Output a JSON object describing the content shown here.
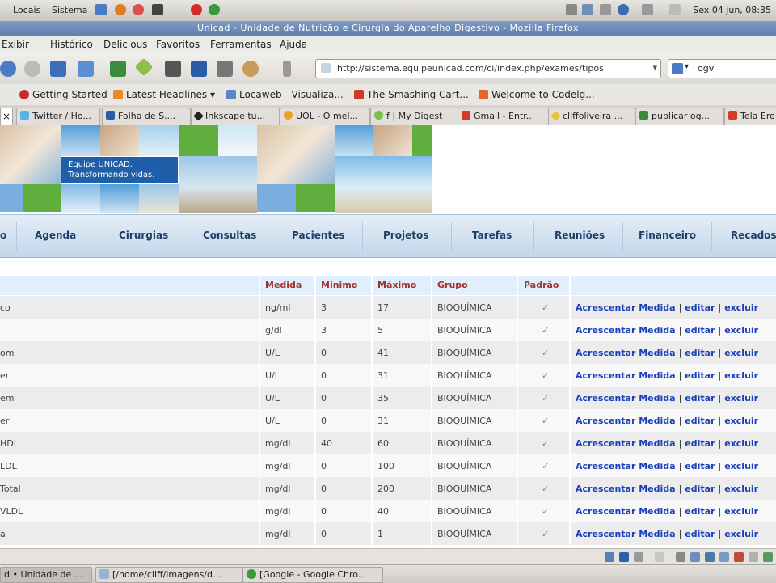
{
  "panel": {
    "menus": [
      "Locais",
      "Sistema"
    ],
    "clock": "Sex 04 jun, 08:35"
  },
  "window": {
    "title": "Unicad - Unidade de Nutrição e Cirurgia do Aparelho Digestivo - Mozilla Firefox"
  },
  "menubar": [
    "Exibir",
    "Histórico",
    "Delicious",
    "Favoritos",
    "Ferramentas",
    "Ajuda"
  ],
  "toolbar": {
    "url": "http://sistema.equipeunicad.com/ci/index.php/exames/tipos",
    "search_value": "ogv"
  },
  "bookmarks": [
    "Getting Started",
    "Latest Headlines",
    "Locaweb - Visualiza...",
    "The Smashing Cart...",
    "Welcome to Codelg..."
  ],
  "tabs": [
    "Twitter / Ho...",
    "Folha de S....",
    "Inkscape tu...",
    "UOL - O mel...",
    "f | My Digest",
    "Gmail - Entr...",
    "cliffoliveira ...",
    "publicar og...",
    "Tela Ero"
  ],
  "banner": {
    "caption_line1": "Equipe UNICAD.",
    "caption_line2": "Transformando vidas."
  },
  "nav": [
    "o",
    "Agenda",
    "Cirurgias",
    "Consultas",
    "Pacientes",
    "Projetos",
    "Tarefas",
    "Reuniões",
    "Financeiro",
    "Recados"
  ],
  "table": {
    "headers": [
      "Medida",
      "Mínimo",
      "Máximo",
      "Grupo",
      "Padrão"
    ],
    "check_mark": "✓",
    "actions": {
      "add": "Acrescentar Medida",
      "edit": "editar",
      "delete": "excluir",
      "sep": "|"
    },
    "rows": [
      {
        "name": "co",
        "medida": "ng/ml",
        "min": "3",
        "max": "17",
        "grupo": "BIOQUÍMICA"
      },
      {
        "name": "",
        "medida": "g/dl",
        "min": "3",
        "max": "5",
        "grupo": "BIOQUÍMICA"
      },
      {
        "name": "om",
        "medida": "U/L",
        "min": "0",
        "max": "41",
        "grupo": "BIOQUÍMICA"
      },
      {
        "name": "er",
        "medida": "U/L",
        "min": "0",
        "max": "31",
        "grupo": "BIOQUÍMICA"
      },
      {
        "name": "em",
        "medida": "U/L",
        "min": "0",
        "max": "35",
        "grupo": "BIOQUÍMICA"
      },
      {
        "name": "er",
        "medida": "U/L",
        "min": "0",
        "max": "31",
        "grupo": "BIOQUÍMICA"
      },
      {
        "name": "HDL",
        "medida": "mg/dl",
        "min": "40",
        "max": "60",
        "grupo": "BIOQUÍMICA"
      },
      {
        "name": "LDL",
        "medida": "mg/dl",
        "min": "0",
        "max": "100",
        "grupo": "BIOQUÍMICA"
      },
      {
        "name": "Total",
        "medida": "mg/dl",
        "min": "0",
        "max": "200",
        "grupo": "BIOQUÍMICA"
      },
      {
        "name": "VLDL",
        "medida": "mg/dl",
        "min": "0",
        "max": "40",
        "grupo": "BIOQUÍMICA"
      },
      {
        "name": "a",
        "medida": "mg/dl",
        "min": "0",
        "max": "1",
        "grupo": "BIOQUÍMICA"
      }
    ]
  },
  "taskbar": [
    "d • Unidade de ...",
    "[/home/cliff/imagens/d...",
    "[Google - Google Chro..."
  ]
}
